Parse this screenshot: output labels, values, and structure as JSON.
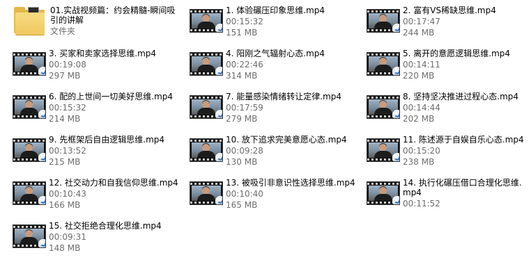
{
  "folder": {
    "name": "01.实战视频篇：约会精髓-瞬间吸引的讲解",
    "type": "文件夹",
    "icon": "folder-icon"
  },
  "videos": [
    {
      "name": "1. 体验碾压印象思维.mp4",
      "duration": "00:15:32",
      "size": "151 MB"
    },
    {
      "name": "2. 富有VS稀缺思维.mp4",
      "duration": "00:17:47",
      "size": "244 MB"
    },
    {
      "name": "3. 买家和卖家选择思维.mp4",
      "duration": "00:19:08",
      "size": "297 MB"
    },
    {
      "name": "4. 阳刚之气辐射心态.mp4",
      "duration": "00:22:46",
      "size": "314 MB"
    },
    {
      "name": "5. 离开的意愿逻辑思维.mp4",
      "duration": "00:14:11",
      "size": "220 MB"
    },
    {
      "name": "6. 配的上世间一切美好思维.mp4",
      "duration": "00:15:32",
      "size": "214 MB"
    },
    {
      "name": "7. 能量感染情绪转让定律.mp4",
      "duration": "00:17:59",
      "size": "279 MB"
    },
    {
      "name": "8. 坚持坚决推进过程心态.mp4",
      "duration": "00:14:44",
      "size": "202 MB"
    },
    {
      "name": "9. 先框架后自由逻辑思维.mp4",
      "duration": "00:13:52",
      "size": "215 MB"
    },
    {
      "name": "10. 放下追求完美意愿心态.mp4",
      "duration": "00:09:28",
      "size": "130 MB"
    },
    {
      "name": "11. 陈述源于自娱自乐心态.mp4",
      "duration": "00:15:20",
      "size": "238 MB"
    },
    {
      "name": "12. 社交动力和自我信仰思维.mp4",
      "duration": "00:10:43",
      "size": "166 MB"
    },
    {
      "name": "13. 被吸引非意识性选择思维.mp4",
      "duration": "00:10:40",
      "size": "165 MB"
    },
    {
      "name": "14. 执行化碾压借口合理化思维.mp4",
      "duration": "00:11:52",
      "size": ""
    },
    {
      "name": "15. 社交拒绝合理化思维.mp4",
      "duration": "00:09:31",
      "size": "148 MB"
    }
  ],
  "icons": {
    "video": "video-file-icon",
    "player_badge": "media-player-badge-icon"
  }
}
